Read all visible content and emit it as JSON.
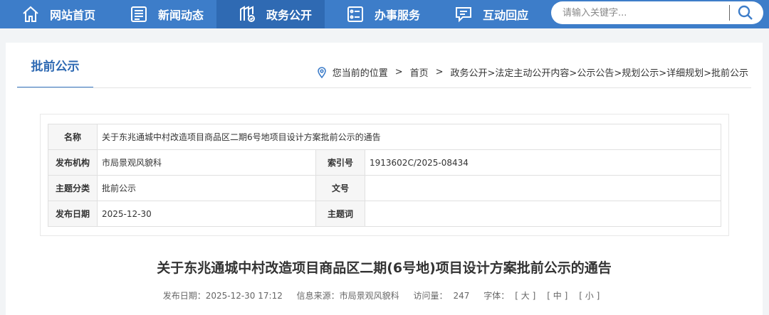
{
  "nav": {
    "items": [
      {
        "label": "网站首页",
        "icon": "home-icon"
      },
      {
        "label": "新闻动态",
        "icon": "news-icon"
      },
      {
        "label": "政务公开",
        "icon": "gov-affairs-icon"
      },
      {
        "label": "办事服务",
        "icon": "service-icon"
      },
      {
        "label": "互动回应",
        "icon": "chat-icon"
      }
    ],
    "active_index": 2,
    "search_placeholder": "请输入关键字..."
  },
  "section": {
    "title": "批前公示"
  },
  "breadcrumb": {
    "prefix": "您当前的位置",
    "sep": ">",
    "home": "首页",
    "path": "政务公开>法定主动公开内容>公示公告>规划公示>详细规划>批前公示"
  },
  "info": {
    "name_label": "名称",
    "name_value": "关于东兆通城中村改造项目商品区二期6号地项目设计方案批前公示的通告",
    "org_label": "发布机构",
    "org_value": "市局景观风貌科",
    "index_label": "索引号",
    "index_value": "1913602C/2025-08434",
    "category_label": "主题分类",
    "category_value": "批前公示",
    "docno_label": "文号",
    "docno_value": "",
    "date_label": "发布日期",
    "date_value": "2025-12-30",
    "keyword_label": "主题词",
    "keyword_value": ""
  },
  "article": {
    "title": "关于东兆通城中村改造项目商品区二期(6号地)项目设计方案批前公示的通告",
    "date_text": "发布日期：2025-12-30 17:12",
    "source_text": "信息来源：市局景观风貌科",
    "views_label": "访问量：",
    "views_value": "247",
    "font_label": "字体：",
    "font_large": "[ 大 ]",
    "font_medium": "[ 中 ]",
    "font_small": "[ 小 ]"
  },
  "colors": {
    "nav_bg": "#3d7dc9",
    "nav_active": "#2f6ab3",
    "accent": "#2f6ab3"
  }
}
